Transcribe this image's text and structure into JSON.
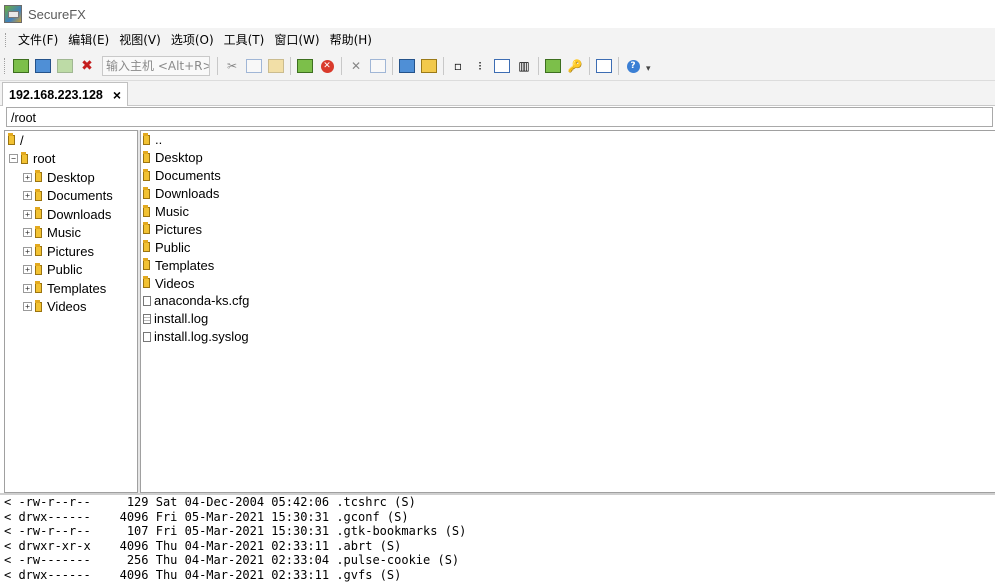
{
  "window": {
    "title": "SecureFX"
  },
  "menu": [
    "文件(F)",
    "编辑(E)",
    "视图(V)",
    "选项(O)",
    "工具(T)",
    "窗口(W)",
    "帮助(H)"
  ],
  "toolbar": {
    "quick_connect_placeholder": "输入主机 <Alt+R>"
  },
  "tab": {
    "label": "192.168.223.128",
    "close": "×"
  },
  "path": "/root",
  "tree": [
    {
      "label": "/",
      "indent": 0,
      "expander": ""
    },
    {
      "label": "root",
      "indent": 1,
      "expander": "−"
    },
    {
      "label": "Desktop",
      "indent": 2,
      "expander": "+"
    },
    {
      "label": "Documents",
      "indent": 2,
      "expander": "+"
    },
    {
      "label": "Downloads",
      "indent": 2,
      "expander": "+"
    },
    {
      "label": "Music",
      "indent": 2,
      "expander": "+"
    },
    {
      "label": "Pictures",
      "indent": 2,
      "expander": "+"
    },
    {
      "label": "Public",
      "indent": 2,
      "expander": "+"
    },
    {
      "label": "Templates",
      "indent": 2,
      "expander": "+"
    },
    {
      "label": "Videos",
      "indent": 2,
      "expander": "+"
    }
  ],
  "files": [
    {
      "name": "..",
      "type": "folder"
    },
    {
      "name": "Desktop",
      "type": "folder"
    },
    {
      "name": "Documents",
      "type": "folder"
    },
    {
      "name": "Downloads",
      "type": "folder"
    },
    {
      "name": "Music",
      "type": "folder"
    },
    {
      "name": "Pictures",
      "type": "folder"
    },
    {
      "name": "Public",
      "type": "folder"
    },
    {
      "name": "Templates",
      "type": "folder"
    },
    {
      "name": "Videos",
      "type": "folder"
    },
    {
      "name": "anaconda-ks.cfg",
      "type": "file"
    },
    {
      "name": "install.log",
      "type": "text"
    },
    {
      "name": "install.log.syslog",
      "type": "file"
    }
  ],
  "log": [
    "< -rw-r--r--     129 Sat 04-Dec-2004 05:42:06 .tcshrc (S)",
    "< drwx------    4096 Fri 05-Mar-2021 15:30:31 .gconf (S)",
    "< -rw-r--r--     107 Fri 05-Mar-2021 15:30:31 .gtk-bookmarks (S)",
    "< drwxr-xr-x    4096 Thu 04-Mar-2021 02:33:11 .abrt (S)",
    "< -rw-------     256 Thu 04-Mar-2021 02:33:04 .pulse-cookie (S)",
    "< drwx------    4096 Thu 04-Mar-2021 02:33:11 .gvfs (S)"
  ]
}
